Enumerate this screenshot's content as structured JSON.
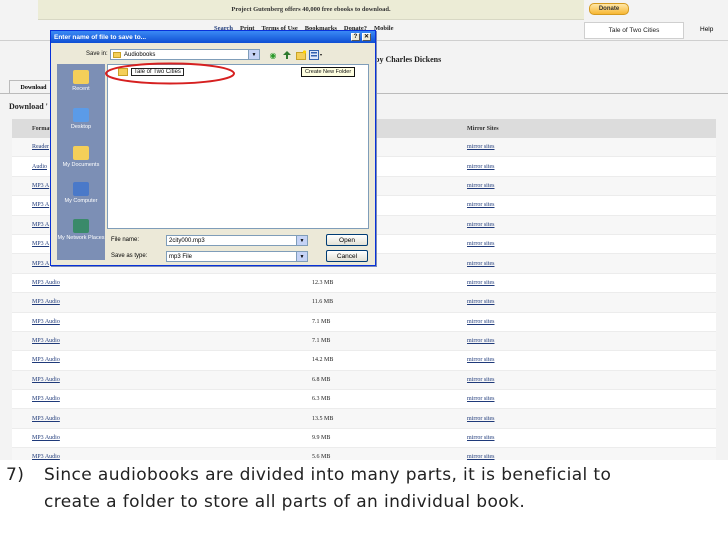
{
  "site": {
    "banner": "Project Gutenberg offers 40,000 free ebooks to download.",
    "donate_button": "Donate",
    "nav": [
      "Search",
      "Print",
      "Terms of Use",
      "Bookmarks",
      "Donate?",
      "Mobile"
    ],
    "search_value": "Tale of Two Cities",
    "help": "Help",
    "book_title_partial": "by Charles Dickens",
    "tab_label": "Download",
    "section_heading_partial": "Download '"
  },
  "table": {
    "headers": {
      "format": "Format",
      "mirror": "Mirror Sites"
    },
    "rows": [
      {
        "format": "Reader",
        "size": "",
        "mirror": "mirror sites"
      },
      {
        "format": "Audio",
        "size": "",
        "mirror": "mirror sites"
      },
      {
        "format": "MP3 A",
        "size": "",
        "mirror": "mirror sites"
      },
      {
        "format": "MP3 A",
        "size": "",
        "mirror": "mirror sites"
      },
      {
        "format": "MP3 A",
        "size": "",
        "mirror": "mirror sites"
      },
      {
        "format": "MP3 A",
        "size": "",
        "mirror": "mirror sites"
      },
      {
        "format": "MP3 A",
        "size": "",
        "mirror": "mirror sites"
      },
      {
        "format": "MP3 Audio",
        "size": "12.3 MB",
        "mirror": "mirror sites"
      },
      {
        "format": "MP3 Audio",
        "size": "11.6 MB",
        "mirror": "mirror sites"
      },
      {
        "format": "MP3 Audio",
        "size": "7.1 MB",
        "mirror": "mirror sites"
      },
      {
        "format": "MP3 Audio",
        "size": "7.1 MB",
        "mirror": "mirror sites"
      },
      {
        "format": "MP3 Audio",
        "size": "14.2 MB",
        "mirror": "mirror sites"
      },
      {
        "format": "MP3 Audio",
        "size": "6.8 MB",
        "mirror": "mirror sites"
      },
      {
        "format": "MP3 Audio",
        "size": "6.3 MB",
        "mirror": "mirror sites"
      },
      {
        "format": "MP3 Audio",
        "size": "13.5 MB",
        "mirror": "mirror sites"
      },
      {
        "format": "MP3 Audio",
        "size": "9.9 MB",
        "mirror": "mirror sites"
      },
      {
        "format": "MP3 Audio",
        "size": "5.6 MB",
        "mirror": "mirror sites"
      }
    ]
  },
  "dialog": {
    "title": "Enter name of file to save to...",
    "title_buttons": {
      "help": "?",
      "close": "✕"
    },
    "save_in_label": "Save in:",
    "save_in_value": "Audiobooks",
    "places": [
      "Recent",
      "Desktop",
      "My Documents",
      "My Computer",
      "My Network Places"
    ],
    "new_folder_name": "Tale of Two Cities",
    "tooltip": "Create New Folder",
    "file_name_label": "File name:",
    "file_name_value": "2city000.mp3",
    "save_as_type_label": "Save as type:",
    "save_as_type_value": "mp3 File",
    "open_button": "Open",
    "cancel_button": "Cancel"
  },
  "caption": {
    "number": "7)",
    "text": "Since audiobooks are divided into many parts, it is beneficial to create a folder to store all parts of an individual book."
  },
  "colors": {
    "highlight_ellipse": "#d62020",
    "dialog_title_bar": "#0f4fd3",
    "places_bar": "#7c8fb5"
  }
}
